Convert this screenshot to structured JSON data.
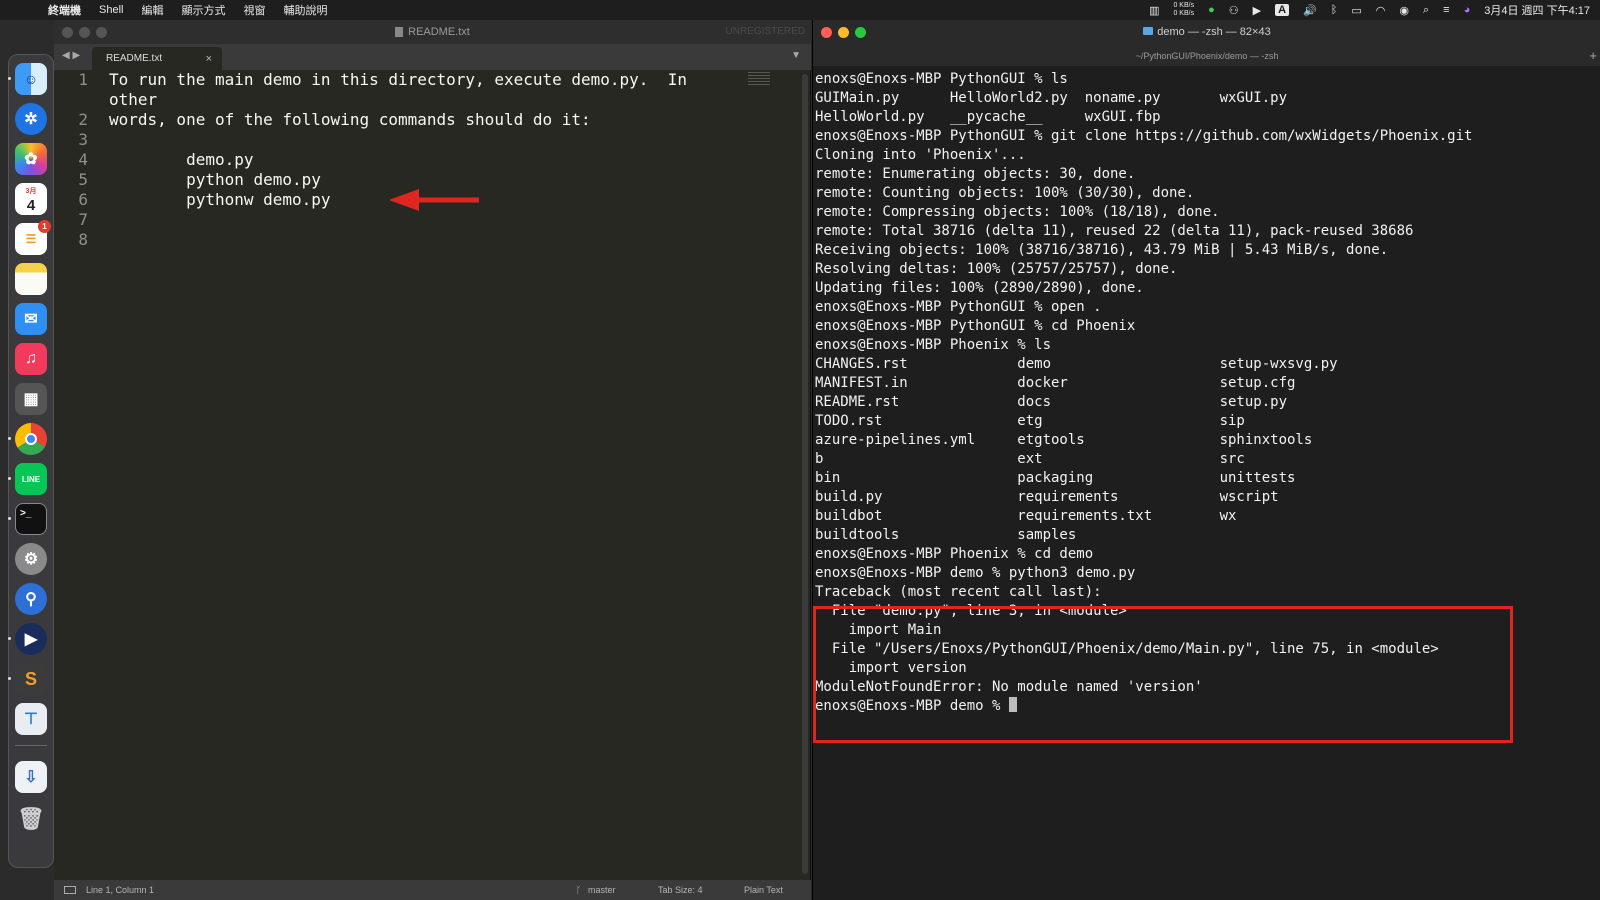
{
  "menubar": {
    "apple_glyph": "",
    "items": [
      "終端機",
      "Shell",
      "編輯",
      "顯示方式",
      "視窗",
      "輔助說明"
    ],
    "net_up": "0 KB/s",
    "net_down": "0 KB/s",
    "input_method": "A",
    "clock": "3月4日 週四 下午4:17"
  },
  "dock": {
    "calendar_month": "3月",
    "calendar_day": "4",
    "reminders_badge": "1",
    "line_label": "LINE"
  },
  "editor": {
    "window_title": "README.txt",
    "unregistered": "UNREGISTERED",
    "tab_label": "README.txt",
    "tab_close": "×",
    "nav_arrows": "◀ ▶",
    "tab_dropdown": "▼",
    "line_numbers": [
      "1",
      "",
      "2",
      "3",
      "4",
      "5",
      "6",
      "7",
      "8"
    ],
    "lines": [
      "To run the main demo in this directory, execute demo.py.  In",
      "other",
      "words, one of the following commands should do it:",
      "",
      "        demo.py",
      "        python demo.py",
      "        pythonw demo.py",
      "",
      ""
    ],
    "status": {
      "position": "Line 1, Column 1",
      "branch": "master",
      "tab_size": "Tab Size: 4",
      "syntax": "Plain Text"
    }
  },
  "terminal": {
    "title": "demo — -zsh — 82×43",
    "subtitle": "~/PythonGUI/Phoenix/demo — -zsh",
    "new_tab": "+",
    "lines": [
      "enoxs@Enoxs-MBP PythonGUI % ls",
      "GUIMain.py      HelloWorld2.py  noname.py       wxGUI.py",
      "HelloWorld.py   __pycache__     wxGUI.fbp",
      "enoxs@Enoxs-MBP PythonGUI % git clone https://github.com/wxWidgets/Phoenix.git",
      "Cloning into 'Phoenix'...",
      "remote: Enumerating objects: 30, done.",
      "remote: Counting objects: 100% (30/30), done.",
      "remote: Compressing objects: 100% (18/18), done.",
      "remote: Total 38716 (delta 11), reused 22 (delta 11), pack-reused 38686",
      "Receiving objects: 100% (38716/38716), 43.79 MiB | 5.43 MiB/s, done.",
      "Resolving deltas: 100% (25757/25757), done.",
      "Updating files: 100% (2890/2890), done.",
      "enoxs@Enoxs-MBP PythonGUI % open .",
      "enoxs@Enoxs-MBP PythonGUI % cd Phoenix",
      "enoxs@Enoxs-MBP Phoenix % ls",
      "CHANGES.rst             demo                    setup-wxsvg.py",
      "MANIFEST.in             docker                  setup.cfg",
      "README.rst              docs                    setup.py",
      "TODO.rst                etg                     sip",
      "azure-pipelines.yml     etgtools                sphinxtools",
      "b                       ext                     src",
      "bin                     packaging               unittests",
      "build.py                requirements            wscript",
      "buildbot                requirements.txt        wx",
      "buildtools              samples",
      "enoxs@Enoxs-MBP Phoenix % cd demo",
      "enoxs@Enoxs-MBP demo % python3 demo.py",
      "Traceback (most recent call last):",
      "  File \"demo.py\", line 3, in <module>",
      "    import Main",
      "  File \"/Users/Enoxs/PythonGUI/Phoenix/demo/Main.py\", line 75, in <module>",
      "    import version",
      "ModuleNotFoundError: No module named 'version'"
    ],
    "prompt": "enoxs@Enoxs-MBP demo % "
  },
  "colors": {
    "annotation_red": "#e0251f",
    "editor_bg": "#272822",
    "terminal_bg": "#1e1e1e"
  }
}
